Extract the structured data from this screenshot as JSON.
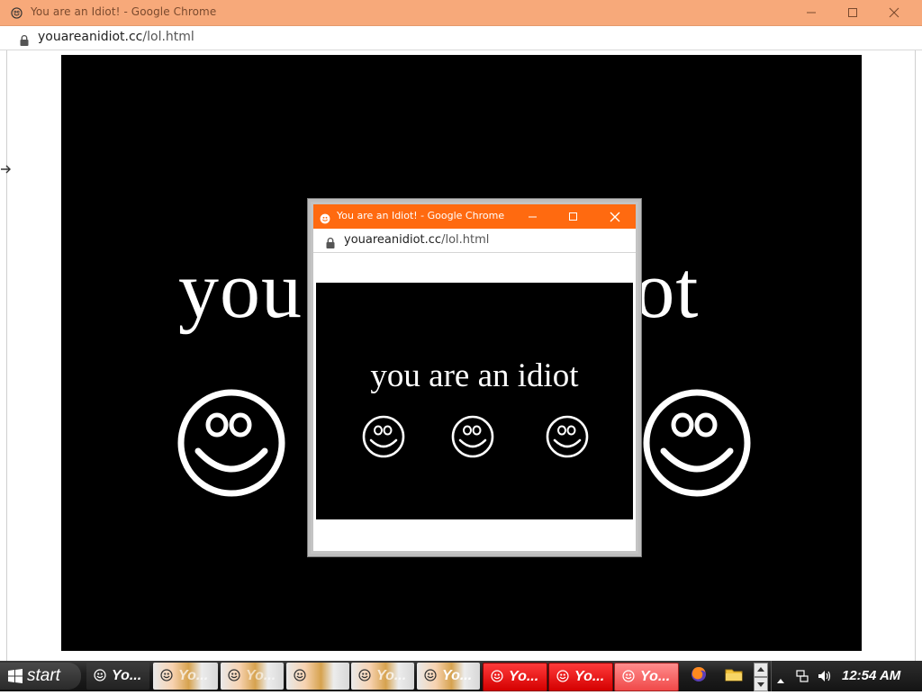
{
  "main_window": {
    "title": "You are an Idiot! - Google Chrome",
    "url_host": "youareanidiot.cc",
    "url_path": "/lol.html",
    "page_text": "you are an idiot"
  },
  "popup_window": {
    "title": "You are an Idiot! - Google Chrome",
    "url_host": "youareanidiot.cc",
    "url_path": "/lol.html",
    "page_text": "you are an idiot",
    "accent": "#ff6a10"
  },
  "taskbar": {
    "start_label": "start",
    "buttons": [
      {
        "label": "Yo..."
      },
      {
        "label": "Yo..."
      },
      {
        "label": "Yo..."
      },
      {
        "label": ""
      },
      {
        "label": "Yo..."
      },
      {
        "label": "Yo..."
      },
      {
        "label": "Yo..."
      },
      {
        "label": "Yo..."
      },
      {
        "label": "Yo..."
      }
    ],
    "quick_launch": [
      "firefox-icon",
      "folder-icon"
    ],
    "clock": "12:54 AM"
  },
  "colors": {
    "main_titlebar": "#f7a97a",
    "popup_titlebar": "#ff6a10",
    "stage_bg": "#000000",
    "taskbar_red": "#e00000"
  }
}
